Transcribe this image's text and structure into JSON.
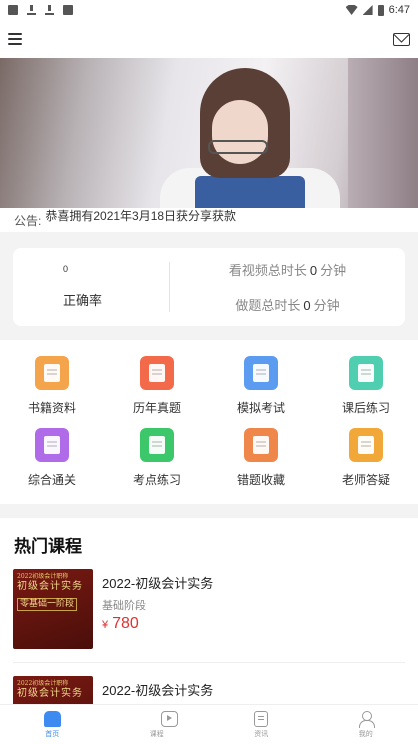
{
  "status_bar": {
    "time": "6:47",
    "left_icons": [
      "notification-icon",
      "download-icon",
      "download-icon",
      "app-icon"
    ],
    "right_icons": [
      "wifi-icon",
      "signal-icon",
      "battery-icon"
    ]
  },
  "header": {
    "menu_icon": "menu-icon",
    "mail_icon": "mail-icon"
  },
  "notice": {
    "label": "公告:",
    "text": "恭喜拥有2021年3月18日获分享获款"
  },
  "stats": {
    "accuracy_value": "0",
    "accuracy_label": "正确率",
    "video_prefix": "看视频总时长",
    "video_value": "0",
    "video_unit": "分钟",
    "question_prefix": "做题总时长",
    "question_value": "0",
    "question_unit": "分钟"
  },
  "grid": [
    {
      "label": "书籍资料",
      "icon": "book-icon",
      "color": "#f4a44b"
    },
    {
      "label": "历年真题",
      "icon": "past-exam-icon",
      "color": "#f26a4a"
    },
    {
      "label": "模拟考试",
      "icon": "mock-exam-icon",
      "color": "#5b9cf0"
    },
    {
      "label": "课后练习",
      "icon": "practice-icon",
      "color": "#4fcfb0"
    },
    {
      "label": "综合通关",
      "icon": "comprehensive-icon",
      "color": "#b06ce8"
    },
    {
      "label": "考点练习",
      "icon": "key-points-icon",
      "color": "#3cc86a"
    },
    {
      "label": "错题收藏",
      "icon": "wrong-questions-icon",
      "color": "#f0874a"
    },
    {
      "label": "老师答疑",
      "icon": "teacher-qa-icon",
      "color": "#f2a838"
    }
  ],
  "courses": {
    "title": "热门课程",
    "items": [
      {
        "thumb_line1": "2022初级会计职称",
        "thumb_line2": "初级会计实务",
        "thumb_line3": "零基础一阶段",
        "name": "2022-初级会计实务",
        "stage": "基础阶段",
        "currency": "¥",
        "price": "780"
      },
      {
        "thumb_line1": "2022初级会计职称",
        "thumb_line2": "初级会计实务",
        "thumb_line3": "",
        "name": "2022-初级会计实务",
        "stage": "",
        "currency": "",
        "price": ""
      }
    ]
  },
  "tabs": [
    {
      "label": "首页",
      "icon": "home-icon",
      "active": true
    },
    {
      "label": "课程",
      "icon": "course-icon",
      "active": false
    },
    {
      "label": "资讯",
      "icon": "news-icon",
      "active": false
    },
    {
      "label": "我的",
      "icon": "profile-icon",
      "active": false
    }
  ],
  "colors": {
    "accent": "#3d8bf0",
    "price": "#e03030"
  }
}
